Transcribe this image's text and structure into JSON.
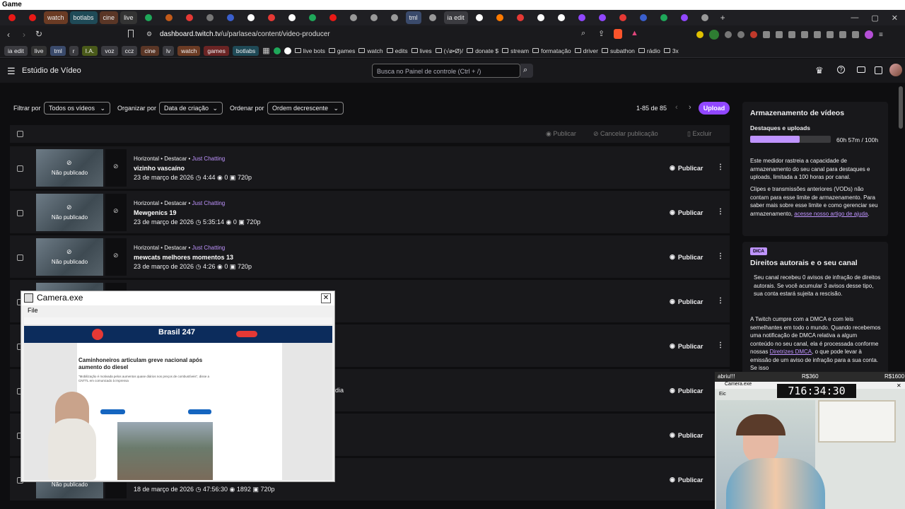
{
  "window": {
    "title": "Game"
  },
  "tabs": [
    {
      "label": "",
      "kind": "icon",
      "color": "#e91916"
    },
    {
      "label": "",
      "kind": "icon",
      "color": "#e91916"
    },
    {
      "label": "watch",
      "color": "#6b3b24"
    },
    {
      "label": "botlabs",
      "color": "#1f4a57"
    },
    {
      "label": "cine",
      "color": "#5a3626"
    },
    {
      "label": "live",
      "color": "#333333"
    },
    {
      "label": "",
      "kind": "icon",
      "color": "#1fa85a"
    },
    {
      "label": "",
      "kind": "icon",
      "color": "#c25a1a"
    },
    {
      "label": "",
      "kind": "icon",
      "color": "#e53935"
    },
    {
      "label": "",
      "kind": "icon",
      "color": "#777777"
    },
    {
      "label": "",
      "kind": "icon",
      "color": "#3a5fcd"
    },
    {
      "label": "",
      "kind": "icon",
      "color": "#ffffff"
    },
    {
      "label": "",
      "kind": "icon",
      "color": "#e53935"
    },
    {
      "label": "",
      "kind": "icon",
      "color": "#ffffff"
    },
    {
      "label": "",
      "kind": "icon",
      "color": "#1fa85a"
    },
    {
      "label": "",
      "kind": "icon",
      "color": "#e91916"
    },
    {
      "label": "",
      "kind": "icon",
      "color": "#999999"
    },
    {
      "label": "",
      "kind": "icon",
      "color": "#999999"
    },
    {
      "label": "",
      "kind": "icon",
      "color": "#999999"
    },
    {
      "label": "tml",
      "color": "#3a4a6b"
    },
    {
      "label": "",
      "kind": "icon",
      "color": "#999999"
    },
    {
      "label": "ia edit",
      "color": "#3b3b40"
    },
    {
      "label": "",
      "kind": "icon",
      "color": "#ffffff"
    },
    {
      "label": "",
      "kind": "icon",
      "color": "#ff7a00"
    },
    {
      "label": "",
      "kind": "icon",
      "color": "#e53935"
    },
    {
      "label": "",
      "kind": "icon",
      "color": "#ffffff"
    },
    {
      "label": "",
      "kind": "icon",
      "color": "#ffffff"
    },
    {
      "label": "",
      "kind": "icon",
      "color": "#9147ff"
    },
    {
      "label": "",
      "kind": "icon",
      "color": "#9147ff"
    },
    {
      "label": "",
      "kind": "icon",
      "color": "#e53935"
    },
    {
      "label": "",
      "kind": "icon",
      "color": "#3a5fcd"
    },
    {
      "label": "",
      "kind": "icon",
      "color": "#1fa85a"
    },
    {
      "label": "",
      "kind": "icon",
      "color": "#9147ff"
    },
    {
      "label": "",
      "kind": "icon",
      "color": "#999999"
    }
  ],
  "address": {
    "url_host": "dashboard.twitch.tv",
    "url_path": "/u/parlasea/content/video-producer"
  },
  "bookmarks": [
    {
      "label": "ia edit",
      "color": "#3b3b40"
    },
    {
      "label": "live",
      "color": "#333333"
    },
    {
      "label": "tml",
      "color": "#3a4a6b"
    },
    {
      "label": "r",
      "color": "#3b3b40"
    },
    {
      "label": "I.A.",
      "color": "#4a5a1a"
    },
    {
      "label": "voz",
      "color": "#3b3b40"
    },
    {
      "label": "ccz",
      "color": "#3b3b40"
    },
    {
      "label": "cine",
      "color": "#5a3626"
    },
    {
      "label": "lv",
      "color": "#3b3b40"
    },
    {
      "label": "watch",
      "color": "#6b3b24"
    },
    {
      "label": "games",
      "color": "#6b2424"
    },
    {
      "label": "botlabs",
      "color": "#1f4a57"
    }
  ],
  "bookmark_folders": [
    "live bots",
    "games",
    "watch",
    "edits",
    "lives",
    "(√ø•Ø)/",
    "donate $",
    "stream",
    "formatação",
    "driver",
    "subathon",
    "rádio",
    "3x"
  ],
  "twitch": {
    "page_title": "Estúdio de Vídeo",
    "search_placeholder": "Busca no Painel de controle (Ctrl + /)"
  },
  "filters": {
    "filter_label": "Filtrar por",
    "filter_value": "Todos os vídeos",
    "organize_label": "Organizar por",
    "organize_value": "Data de criação",
    "order_label": "Ordenar por",
    "order_value": "Ordem decrescente",
    "range": "1-85 de 85",
    "upload": "Upload"
  },
  "table_actions": {
    "publish": "Publicar",
    "cancel": "Cancelar publicação",
    "delete": "Excluir"
  },
  "videos": [
    {
      "meta": "Horizontal • Destacar • ",
      "category": "Just Chatting",
      "title": "vizinho vascaíno",
      "date": "23 de março de 2026",
      "duration": "4:44",
      "views": "0",
      "quality": "720p",
      "status": "Não publicado",
      "action": "Publicar"
    },
    {
      "meta": "Horizontal • Destacar • ",
      "category": "Just Chatting",
      "title": "Mewgenics 19",
      "date": "23 de março de 2026",
      "duration": "5:35:14",
      "views": "0",
      "quality": "720p",
      "status": "Não publicado",
      "action": "Publicar"
    },
    {
      "meta": "Horizontal • Destacar • ",
      "category": "Just Chatting",
      "title": "mewcats melhores momentos 13",
      "date": "23 de março de 2026",
      "duration": "4:26",
      "views": "0",
      "quality": "720p",
      "status": "Não publicado",
      "action": "Publicar"
    },
    {
      "action": "Publicar"
    },
    {
      "action": "Publicar"
    },
    {
      "action": "Publicar",
      "tail": "dia"
    },
    {
      "action": "Publicar"
    },
    {
      "date": "18 de março de 2026",
      "duration": "47:56:30",
      "views": "1892",
      "quality": "720p",
      "status": "Não publicado",
      "action": "Publicar"
    }
  ],
  "storage": {
    "title": "Armazenamento de vídeos",
    "subtitle": "Destaques e uploads",
    "usage": "60h 57m / 100h",
    "progress": 0.61,
    "desc": "Este medidor rastreia a capacidade de armazenamento do seu canal para destaques e uploads, limitada a 100 horas por canal.",
    "desc2": "Clipes e transmissões anteriores (VODs) não contam para esse limite de armazenamento. Para saber mais sobre esse limite e como gerenciar seu armazenamento, ",
    "link": "acesse nosso artigo de ajuda",
    "end": "."
  },
  "tip": {
    "badge": "DICA",
    "title": "Direitos autorais e o seu canal",
    "desc": "Seu canal recebeu 0 avisos de infração de direitos autorais. Se você acumular 3 avisos desse tipo, sua conta estará sujeita a rescisão.",
    "desc2": "A Twitch cumpre com a DMCA e com leis semelhantes em todo o mundo. Quando recebemos uma notificação de DMCA relativa a algum conteúdo no seu canal, ela é processada conforme nossas ",
    "link": "Diretrizes DMCA",
    "desc3": ", o que pode levar à emissão de um aviso de infração para a sua conta. Se isso"
  },
  "camera_window": {
    "title": "Camera.exe",
    "menu": "File"
  },
  "article": {
    "brand": "Brasil 247",
    "headline": "Caminhoneiros articulam greve nacional após aumento do diesel",
    "lead": "\"Mobilização é motivada pelos aumentos quase diários nos preços de combustíveis\", disse a CNTTL em comunicado à imprensa"
  },
  "small_cam": {
    "label": "abriu!!!",
    "r1": "R$360",
    "r2": "R$1600",
    "window": "Camera.exe",
    "timer": "716:34:30",
    "menu": "Eic"
  }
}
